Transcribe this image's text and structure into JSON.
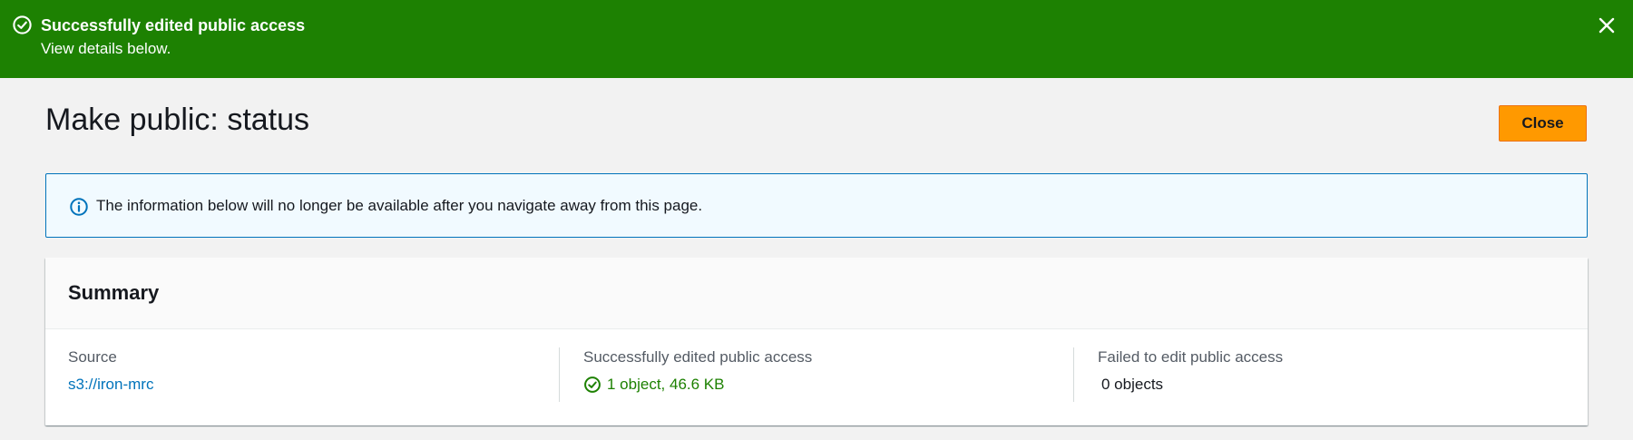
{
  "flash": {
    "title": "Successfully edited public access",
    "subtitle": "View details below.",
    "icon": "check-circle-icon",
    "close_icon": "close-icon",
    "background": "#1d8102"
  },
  "page": {
    "title": "Make public: status",
    "close_label": "Close",
    "accent": "#ff9900"
  },
  "info_alert": {
    "icon": "info-icon",
    "text": "The information below will no longer be available after you navigate away from this page."
  },
  "summary": {
    "title": "Summary",
    "source": {
      "label": "Source",
      "value": "s3://iron-mrc"
    },
    "succeeded": {
      "label": "Successfully edited public access",
      "value": "1 object, 46.6 KB",
      "icon": "check-circle-icon"
    },
    "failed": {
      "label": "Failed to edit public access",
      "value": "0 objects"
    }
  }
}
